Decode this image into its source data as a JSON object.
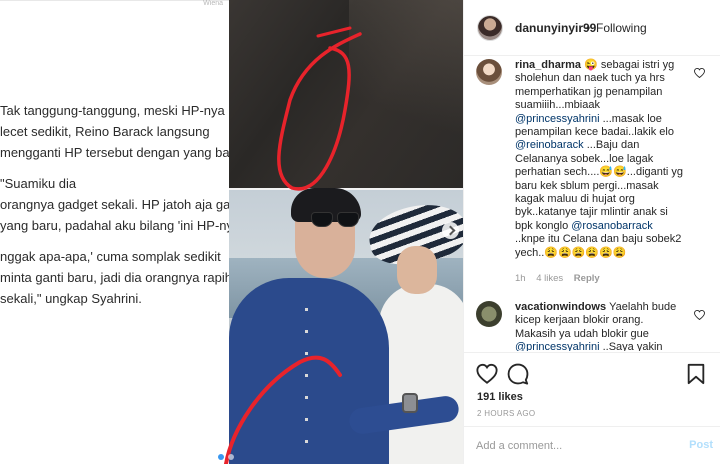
{
  "post": {
    "owner": "danunyinyir99",
    "separator": "•",
    "follow_status": "Following",
    "article_lines": [
      "Tak tanggung-tanggung, meski HP-nya",
      "lecet sedikit, Reino Barack langsung",
      "mengganti HP tersebut dengan yang baru.",
      "\"Suamiku dia",
      "orangnya gadget sekali. HP jatoh aja ganti",
      "yang baru, padahal aku bilang 'ini HP-nya",
      "nggak apa-apa,' cuma somplak sedikit",
      "minta ganti baru, jadi dia orangnya rapih",
      "sekali,\" ungkap Syahrini."
    ],
    "watermark": "Wiena",
    "icons": {
      "next": "chevron-right-icon",
      "like": "heart-icon",
      "comment": "speech-bubble-icon",
      "save": "bookmark-icon"
    }
  },
  "comments": [
    {
      "author": "rina_dharma",
      "lines": [
        [
          {
            "t": "😜 sebagai istri yg"
          }
        ],
        [
          {
            "t": "sholehun dan naek tuch ya hrs"
          }
        ],
        [
          {
            "t": "memperhatikan jg penampilan"
          }
        ],
        [
          {
            "t": "suamiiih...mbiaak"
          }
        ],
        [
          {
            "t": "@princessyahrini",
            "m": true
          },
          {
            "t": " ...masak loe"
          }
        ],
        [
          {
            "t": "penampilan kece badai..lakik elo"
          }
        ],
        [
          {
            "t": "@reinobarack",
            "m": true
          },
          {
            "t": " ...Baju dan"
          }
        ],
        [
          {
            "t": "Celananya sobek...loe lagak"
          }
        ],
        [
          {
            "t": "perhatian sech....😅😅...diganti yg"
          }
        ],
        [
          {
            "t": "baru kek sblum pergi...masak"
          }
        ],
        [
          {
            "t": "kagak maluu di hujat org"
          }
        ],
        [
          {
            "t": "byk..katanye tajir mlintir anak si"
          }
        ],
        [
          {
            "t": "bpk konglo "
          },
          {
            "t": "@rosanobarrack",
            "m": true
          }
        ],
        [
          {
            "t": "..knpe itu Celana dan baju sobek2"
          }
        ],
        [
          {
            "t": "yech..😩😩😩😩😩😩"
          }
        ]
      ],
      "time": "1h",
      "likes": "4 likes",
      "reply": "Reply"
    },
    {
      "author": "vacationwindows",
      "lines": [
        [
          {
            "t": "Yaelahh bude"
          }
        ],
        [
          {
            "t": "kicep kerjaan blokir orang."
          }
        ],
        [
          {
            "t": "Makasih ya udah blokir gue"
          }
        ],
        [
          {
            "t": "@princessyahrini",
            "m": true
          },
          {
            "t": " ..Saya yakin"
          }
        ]
      ]
    }
  ],
  "likes_count": "191 likes",
  "timestamp": "2 HOURS AGO",
  "add_comment": {
    "placeholder": "Add a comment...",
    "post_label": "Post"
  },
  "colors": {
    "accent": "#3897f0",
    "mention": "#003569",
    "muted": "#999999",
    "annotation": "#e8232b"
  }
}
